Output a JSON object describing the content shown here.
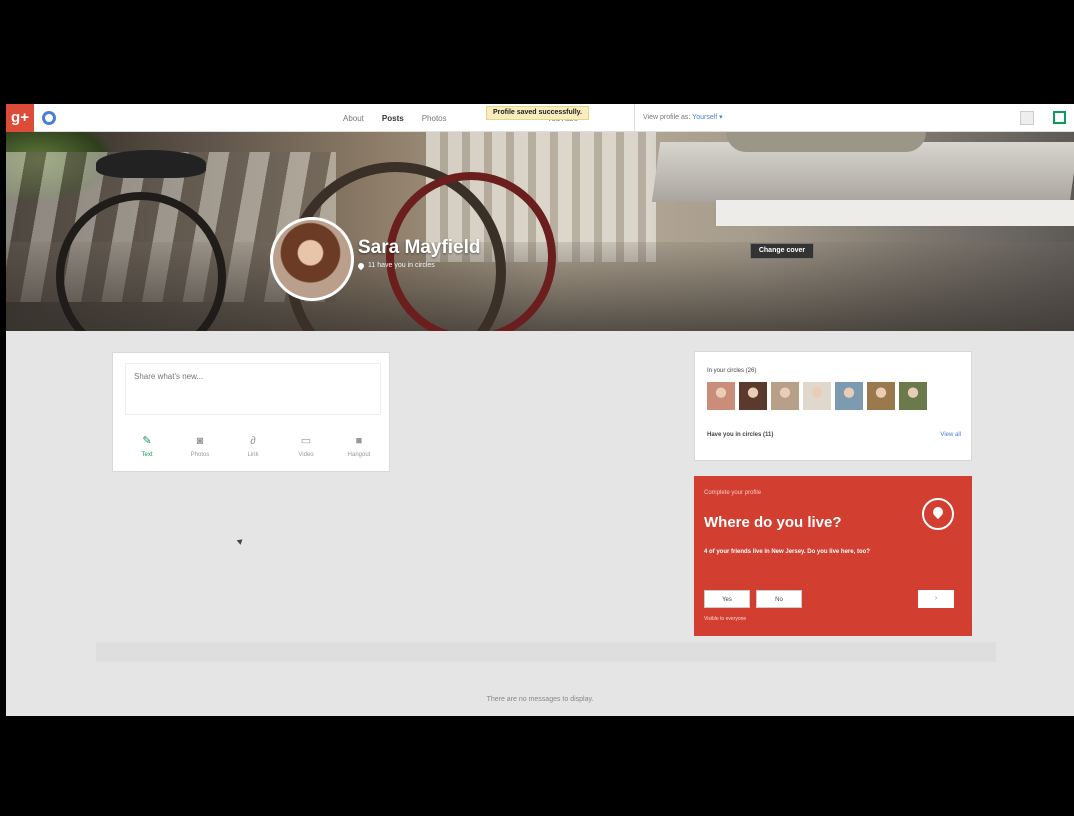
{
  "topbar": {
    "tabs": [
      "About",
      "Posts",
      "Photos",
      "",
      "YouTube"
    ],
    "toast": "Profile saved successfully.",
    "view_as_label": "View profile as:",
    "view_as_value": "Yourself ▾"
  },
  "profile": {
    "name": "Sara Mayfield",
    "subline": "11 have you in circles",
    "change_cover": "Change cover"
  },
  "post_box": {
    "placeholder": "Share what's new...",
    "actions": [
      {
        "label": "Text",
        "icon": "pencil-icon",
        "glyph": "✎"
      },
      {
        "label": "Photos",
        "icon": "camera-icon",
        "glyph": "◙"
      },
      {
        "label": "Link",
        "icon": "link-icon",
        "glyph": "∂"
      },
      {
        "label": "Video",
        "icon": "video-icon",
        "glyph": "▭"
      },
      {
        "label": "Hangout",
        "icon": "hangout-icon",
        "glyph": "■"
      }
    ]
  },
  "circles": {
    "title": "In your circles (26)",
    "have_you": "Have you in circles (11)",
    "view_all": "View all",
    "avatar_colors": [
      "#c98d7a",
      "#5a3a2c",
      "#b8a088",
      "#e0d8cc",
      "#7c9bb0",
      "#9a7a4c",
      "#6a7a4a"
    ]
  },
  "complete_profile": {
    "title": "Complete your profile",
    "heading": "Where do you live?",
    "description": "4 of your friends live in New Jersey. Do you live here, too?",
    "yes": "Yes",
    "no": "No",
    "next": "›",
    "visible": "Visible to everyone"
  },
  "stream": {
    "empty_message": "There are no messages to display."
  },
  "colors": {
    "brand_red": "#dd4b39",
    "card_red": "#d23f31",
    "accent_green": "#0a9d58",
    "link_blue": "#4a7fd8"
  }
}
